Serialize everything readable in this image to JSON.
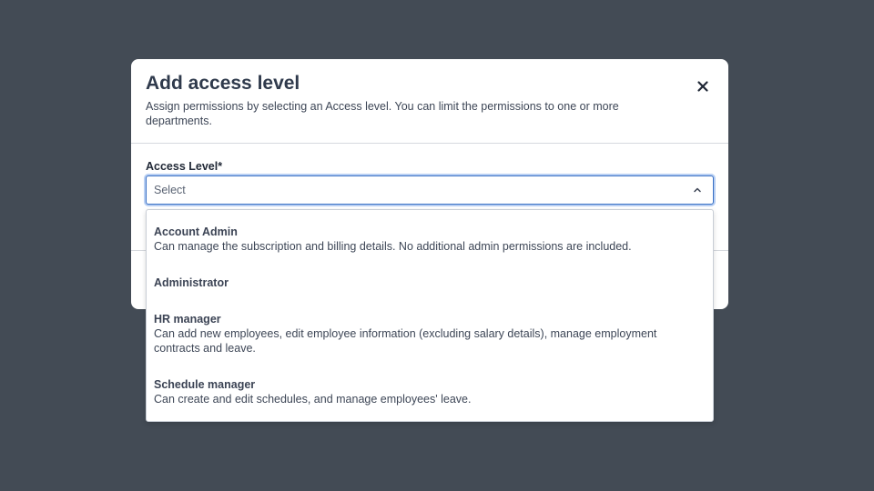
{
  "modal": {
    "title": "Add access level",
    "subtitle": "Assign permissions by selecting an Access level. You can limit the permissions to one or more departments.",
    "close_icon": "close-icon"
  },
  "access_level": {
    "label": "Access Level*",
    "placeholder": "Select",
    "chevron_icon": "chevron-up-icon",
    "focus_color": "#3a70c4"
  },
  "options": [
    {
      "title": "Account Admin",
      "description": "Can manage the subscription and billing details. No additional admin permissions are included."
    },
    {
      "title": "Administrator",
      "description": ""
    },
    {
      "title": "HR manager",
      "description": "Can add new employees, edit employee information (excluding salary details), manage employment contracts and leave."
    },
    {
      "title": "Schedule manager",
      "description": "Can create and edit schedules, and manage employees' leave."
    }
  ],
  "colors": {
    "backdrop": "#434b55",
    "title": "#2f3a4c"
  }
}
